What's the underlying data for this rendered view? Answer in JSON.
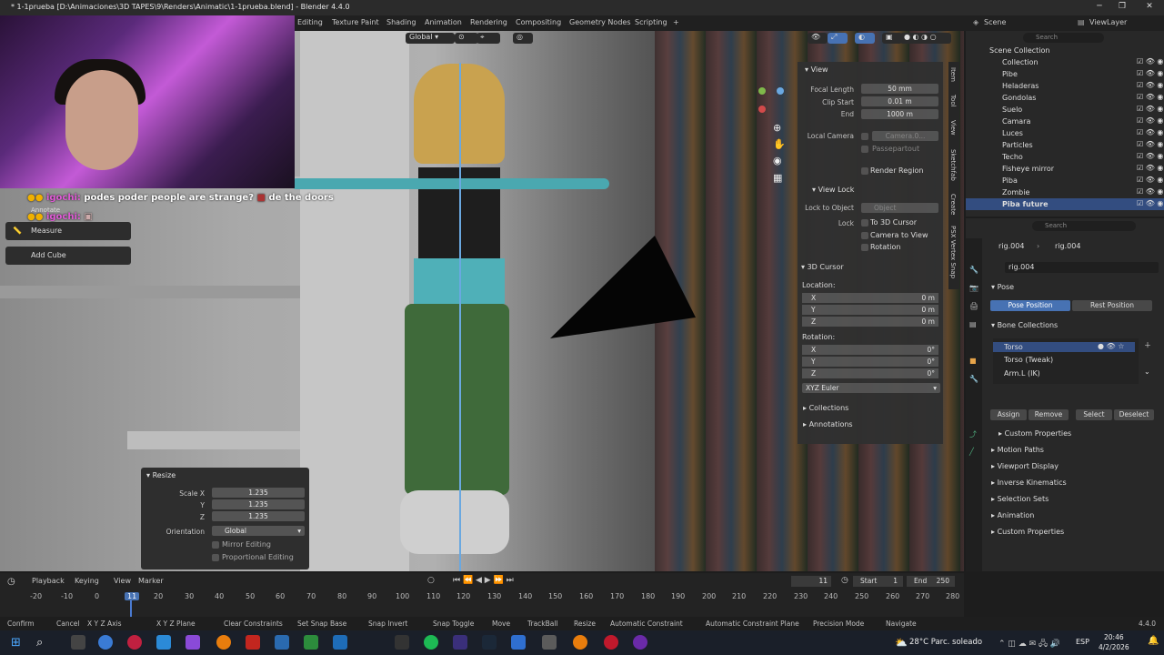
{
  "window": {
    "title": "* 1-1prueba [D:\\Animaciones\\3D TAPES\\9\\Renders\\Animatic\\1-1prueba.blend] - Blender 4.4.0",
    "minimize": "─",
    "maximize": "❐",
    "close": "✕"
  },
  "workspaces": [
    "Editing",
    "Texture Paint",
    "Shading",
    "Animation",
    "Rendering",
    "Compositing",
    "Geometry Nodes",
    "Scripting",
    "+"
  ],
  "scene": {
    "scene_label": "Scene",
    "viewlayer_label": "ViewLayer"
  },
  "chat": {
    "line1_user": "igochi:",
    "line1_text": "podes poder people are strange?",
    "line1_tail": "de the doors",
    "line2_user": "igochi:",
    "annotate": "Annotate"
  },
  "tools": {
    "measure": "Measure",
    "add_cube": "Add Cube"
  },
  "viewport_header": {
    "orientation": "Global"
  },
  "npanel": {
    "view_title": "View",
    "focal_length_label": "Focal Length",
    "focal_length": "50 mm",
    "clip_start_label": "Clip Start",
    "clip_start": "0.01 m",
    "end_label": "End",
    "end": "1000 m",
    "local_camera_label": "Local Camera",
    "local_camera": "Camera.0...",
    "passepartout": "Passepartout",
    "render_region": "Render Region",
    "view_lock_title": "View Lock",
    "lock_to_object_label": "Lock to Object",
    "lock_to_object": "Object",
    "lock_label": "Lock",
    "to_3d_cursor": "To 3D Cursor",
    "camera_to_view": "Camera to View",
    "rotation_lock": "Rotation",
    "cursor_title": "3D Cursor",
    "location_label": "Location:",
    "x_label": "X",
    "y_label": "Y",
    "z_label": "Z",
    "loc_x": "0 m",
    "loc_y": "0 m",
    "loc_z": "0 m",
    "rotation_label": "Rotation:",
    "rot_x": "0°",
    "rot_y": "0°",
    "rot_z": "0°",
    "rotation_mode": "XYZ Euler",
    "collections_title": "Collections",
    "annotations_title": "Annotations"
  },
  "side_tabs": [
    "Item",
    "Tool",
    "View",
    "Sketchfab",
    "Create",
    "PSX Vertex Snap"
  ],
  "resize_panel": {
    "title": "Resize",
    "scale_x_label": "Scale X",
    "y_label": "Y",
    "z_label": "Z",
    "scale_x": "1.235",
    "scale_y": "1.235",
    "scale_z": "1.235",
    "orientation_label": "Orientation",
    "orientation": "Global",
    "mirror_editing": "Mirror Editing",
    "proportional_editing": "Proportional Editing"
  },
  "outliner": {
    "search_placeholder": "Search",
    "scene_collection": "Scene Collection",
    "items": [
      "Collection",
      "Pibe",
      "Heladeras",
      "Gondolas",
      "Suelo",
      "Camara",
      "Luces",
      "Particles",
      "Techo",
      "Fisheye mirror",
      "Piba",
      "Zombie",
      "Piba future"
    ]
  },
  "properties": {
    "search_placeholder": "Search",
    "breadcrumb_object": "rig.004",
    "breadcrumb_data": "rig.004",
    "armature_name": "rig.004",
    "pose_title": "Pose",
    "pose_position": "Pose Position",
    "rest_position": "Rest Position",
    "bone_collections_title": "Bone Collections",
    "bone_collections": [
      "Torso",
      "Torso (Tweak)",
      "Arm.L (IK)"
    ],
    "assign": "Assign",
    "remove": "Remove",
    "select": "Select",
    "deselect": "Deselect",
    "custom_properties_sub": "Custom Properties",
    "motion_paths": "Motion Paths",
    "viewport_display": "Viewport Display",
    "inverse_kinematics": "Inverse Kinematics",
    "selection_sets": "Selection Sets",
    "animation": "Animation",
    "custom_properties": "Custom Properties"
  },
  "timeline": {
    "playback": "Playback",
    "keying": "Keying",
    "view": "View",
    "marker": "Marker",
    "current_frame": "11",
    "start_label": "Start",
    "start": "1",
    "end_label": "End",
    "end": "250",
    "ticks": [
      "-20",
      "-10",
      "0",
      "11",
      "20",
      "30",
      "40",
      "50",
      "60",
      "70",
      "80",
      "90",
      "100",
      "110",
      "120",
      "130",
      "140",
      "150",
      "160",
      "170",
      "180",
      "190",
      "200",
      "210",
      "220",
      "230",
      "240",
      "250",
      "260",
      "270",
      "280"
    ]
  },
  "statusbar": {
    "items": [
      "Confirm",
      "Cancel",
      "X Y Z Axis",
      "X Y Z Plane",
      "Clear Constraints",
      "Set Snap Base",
      "Snap Invert",
      "Snap Toggle",
      "Move",
      "TrackBall",
      "Resize",
      "Automatic Constraint",
      "Automatic Constraint Plane",
      "Precision Mode",
      "Navigate"
    ],
    "version": "4.4.0"
  },
  "taskbar": {
    "weather": "28°C  Parc. soleado",
    "lang": "ESP",
    "time": "20:46",
    "date": "4/2/2026"
  },
  "colors": {
    "accent": "#4772b3",
    "header": "#2b2b2b",
    "panel": "#303030"
  }
}
